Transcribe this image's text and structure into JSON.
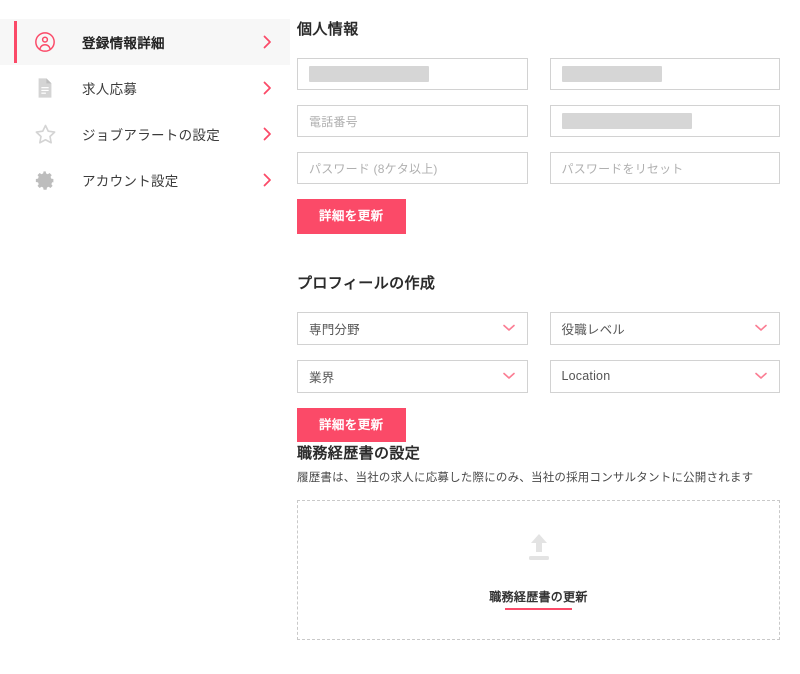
{
  "accent": "#fb4a68",
  "sidebar": {
    "items": [
      {
        "label": "登録情報詳細",
        "icon": "user-circle-icon",
        "active": true
      },
      {
        "label": "求人応募",
        "icon": "document-icon",
        "active": false
      },
      {
        "label": "ジョブアラートの設定",
        "icon": "star-icon",
        "active": false
      },
      {
        "label": "アカウント設定",
        "icon": "gear-icon",
        "active": false
      }
    ]
  },
  "personal_info": {
    "title": "個人情報",
    "fields": [
      {
        "name": "first-name",
        "value": "",
        "placeholder": "",
        "redacted": true,
        "redact_width": 120
      },
      {
        "name": "last-name",
        "value": "",
        "placeholder": "",
        "redacted": true,
        "redact_width": 100
      },
      {
        "name": "phone",
        "value": "",
        "placeholder": "電話番号",
        "redacted": false
      },
      {
        "name": "email",
        "value": "",
        "placeholder": "",
        "redacted": true,
        "redact_width": 130
      },
      {
        "name": "password",
        "value": "",
        "placeholder": "パスワード (8ケタ以上)",
        "redacted": false
      },
      {
        "name": "password-reset",
        "value": "",
        "placeholder": "パスワードをリセット",
        "redacted": false
      }
    ],
    "update_button": "詳細を更新"
  },
  "profile": {
    "title": "プロフィールの作成",
    "selects": [
      {
        "name": "specialism",
        "value": "専門分野"
      },
      {
        "name": "job-level",
        "value": "役職レベル"
      },
      {
        "name": "industry",
        "value": "業界"
      },
      {
        "name": "location",
        "value": "Location"
      }
    ],
    "update_button": "詳細を更新"
  },
  "resume": {
    "title": "職務経歴書の設定",
    "description": "履歴書は、当社の求人に応募した際にのみ、当社の採用コンサルタントに公開されます",
    "upload_label": "職務経歴書の更新",
    "upload_icon": "upload-arrow-icon"
  }
}
